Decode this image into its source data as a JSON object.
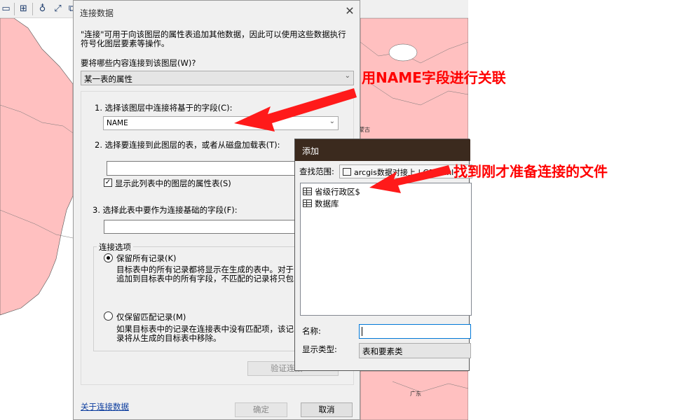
{
  "map": {
    "land_color": "#ffc0c0",
    "sea_color": "#ffffff",
    "labels": [
      "蒙古",
      "广东"
    ]
  },
  "toolbar": {
    "icons": [
      "catalog-icon",
      "measure-icon",
      "find-binoculars-icon",
      "goto-xy-icon",
      "create-viewer-icon"
    ]
  },
  "join_dialog": {
    "title": "连接数据",
    "description": "\"连接\"可用于向该图层的属性表追加其他数据，因此可以使用这些数据执行符号化图层要素等操作。",
    "what_to_join_label": "要将哪些内容连接到该图层(W)?",
    "what_to_join_value": "某一表的属性",
    "step1_label": "1.  选择该图层中连接将基于的字段(C):",
    "step1_value": "NAME",
    "step2_label": "2.  选择要连接到此图层的表，或者从磁盘加载表(T):",
    "step2_value": "",
    "show_attr_tables_label": "显示此列表中的图层的属性表(S)",
    "show_attr_tables_checked": true,
    "step3_label": "3.  选择此表中要作为连接基础的字段(F):",
    "step3_value": "",
    "join_options_title": "连接选项",
    "keep_all_label": "保留所有记录(K)",
    "keep_all_desc": "目标表中的所有记录都将显示在生成的表中。对于追加到目标表中的所有字段，不匹配的记录将只包",
    "keep_matching_label": "仅保留匹配记录(M)",
    "keep_matching_desc": "如果目标表中的记录在连接表中没有匹配项，该记录将从生成的目标表中移除。",
    "validate_button": "验证连接",
    "about_link": "关于连接数据",
    "ok_button": "确定",
    "cancel_button": "取消"
  },
  "add_dialog": {
    "title": "添加",
    "look_in_label": "查找范围:",
    "look_in_value": "arcgis数据对接上 | GDP1.xl",
    "items": [
      {
        "name": "省级行政区$",
        "icon": "table-icon"
      },
      {
        "name": "数据库",
        "icon": "table-icon"
      }
    ],
    "name_label": "名称:",
    "name_value": "",
    "show_type_label": "显示类型:",
    "show_type_value": "表和要素类"
  },
  "annotations": {
    "note1": "用NAME字段进行关联",
    "note2": "找到刚才准备连接的文件",
    "color": "#ff0000"
  }
}
